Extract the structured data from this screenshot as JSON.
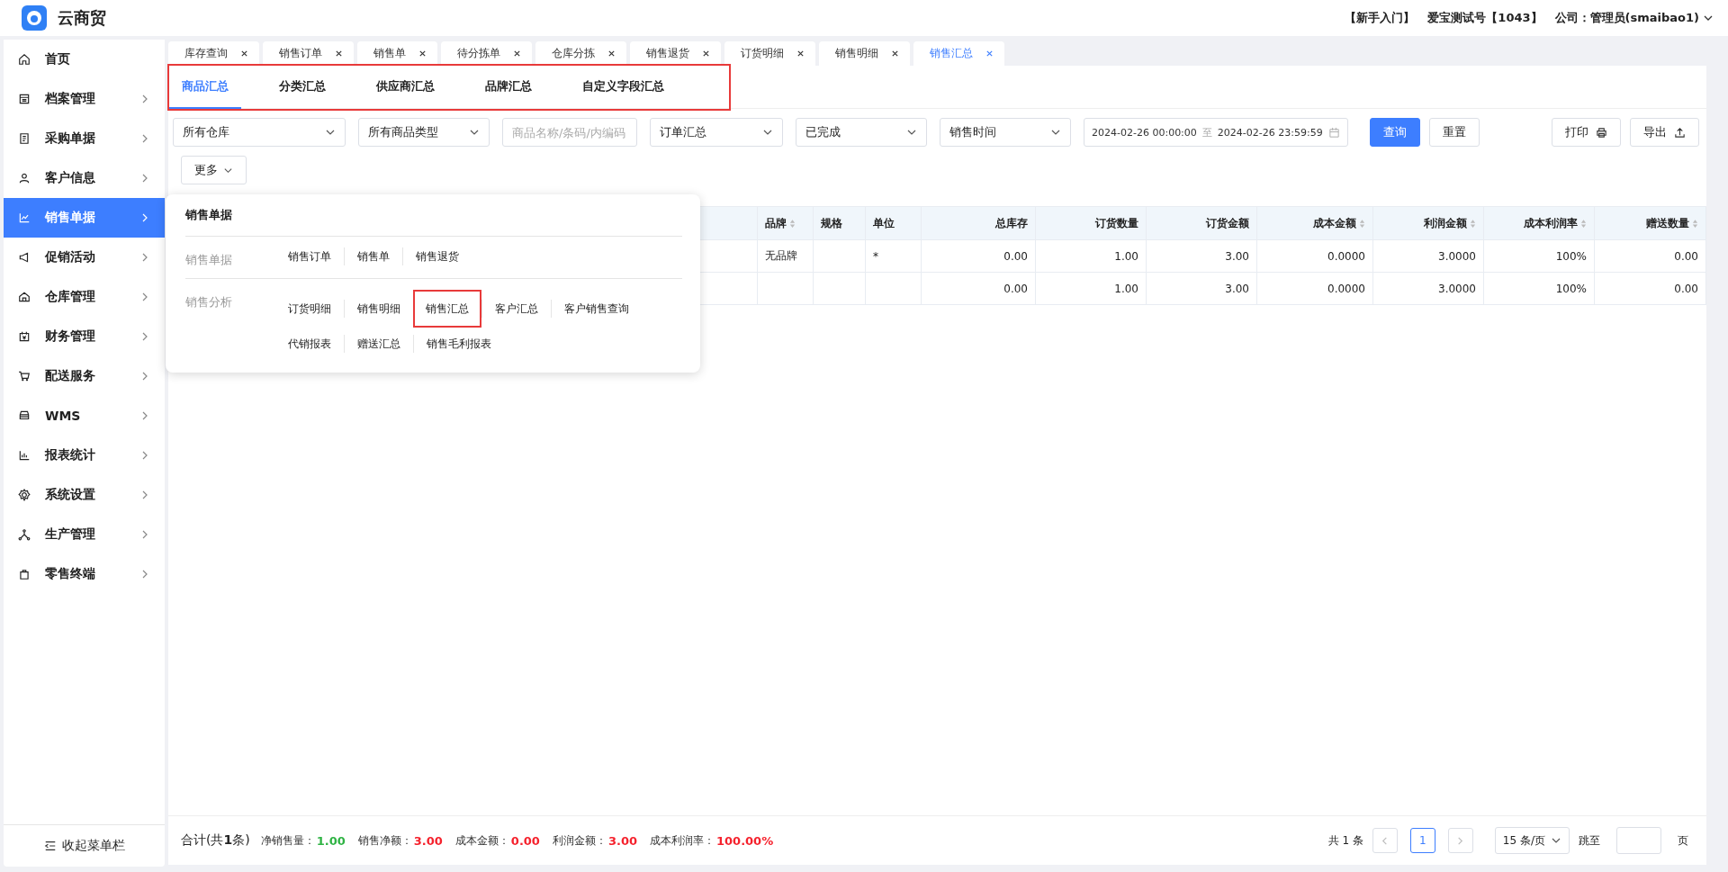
{
  "app": {
    "name": "云商贸"
  },
  "header": {
    "links": [
      "【新手入门】",
      "爱宝测试号【1043】",
      "公司：管理员(smaibao1)"
    ]
  },
  "sidebar": {
    "items": [
      {
        "label": "首页",
        "selected": false,
        "has_arrow": false
      },
      {
        "label": "档案管理",
        "selected": false,
        "has_arrow": true
      },
      {
        "label": "采购单据",
        "selected": false,
        "has_arrow": true
      },
      {
        "label": "客户信息",
        "selected": false,
        "has_arrow": true
      },
      {
        "label": "销售单据",
        "selected": true,
        "has_arrow": true
      },
      {
        "label": "促销活动",
        "selected": false,
        "has_arrow": true
      },
      {
        "label": "仓库管理",
        "selected": false,
        "has_arrow": true
      },
      {
        "label": "财务管理",
        "selected": false,
        "has_arrow": true
      },
      {
        "label": "配送服务",
        "selected": false,
        "has_arrow": true
      },
      {
        "label": "WMS",
        "selected": false,
        "has_arrow": true
      },
      {
        "label": "报表统计",
        "selected": false,
        "has_arrow": true
      },
      {
        "label": "系统设置",
        "selected": false,
        "has_arrow": true
      },
      {
        "label": "生产管理",
        "selected": false,
        "has_arrow": true
      },
      {
        "label": "零售终端",
        "selected": false,
        "has_arrow": true
      }
    ],
    "collapse_label": "收起菜单栏"
  },
  "tabs": [
    {
      "label": "库存查询",
      "selected": false
    },
    {
      "label": "销售订单",
      "selected": false
    },
    {
      "label": "销售单",
      "selected": false
    },
    {
      "label": "待分拣单",
      "selected": false
    },
    {
      "label": "仓库分拣",
      "selected": false
    },
    {
      "label": "销售退货",
      "selected": false
    },
    {
      "label": "订货明细",
      "selected": false
    },
    {
      "label": "销售明细",
      "selected": false
    },
    {
      "label": "销售汇总",
      "selected": true
    }
  ],
  "subtabs": {
    "highlighted": true,
    "items": [
      {
        "label": "商品汇总",
        "selected": true
      },
      {
        "label": "分类汇总",
        "selected": false
      },
      {
        "label": "供应商汇总",
        "selected": false
      },
      {
        "label": "品牌汇总",
        "selected": false
      },
      {
        "label": "自定义字段汇总",
        "selected": false
      }
    ]
  },
  "filters": [
    {
      "kind": "select",
      "value": "所有仓库"
    },
    {
      "kind": "select",
      "value": "所有商品类型"
    },
    {
      "kind": "input",
      "placeholder": "商品名称/条码/内编码"
    },
    {
      "kind": "select",
      "value": "订单汇总"
    },
    {
      "kind": "select",
      "value": "已完成"
    },
    {
      "kind": "select",
      "value": "销售时间"
    },
    {
      "kind": "daterange",
      "start": "2024-02-26 00:00:00",
      "separator": "至",
      "end": "2024-02-26 23:59:59"
    }
  ],
  "buttons": [
    {
      "label": "查询",
      "kind": "primary"
    },
    {
      "label": "重置",
      "kind": "default"
    }
  ],
  "tools": [
    {
      "label": "打印",
      "kind": "print"
    },
    {
      "label": "导出",
      "kind": "export"
    }
  ],
  "more_button": "更多",
  "table": {
    "columns": [
      {
        "label": "品牌",
        "sortable": true
      },
      {
        "label": "规格",
        "sortable": false
      },
      {
        "label": "单位",
        "sortable": false
      },
      {
        "label": "总库存",
        "sortable": false
      },
      {
        "label": "订货数量",
        "sortable": false
      },
      {
        "label": "订货金额",
        "sortable": false
      },
      {
        "label": "成本金额",
        "sortable": true
      },
      {
        "label": "利润金额",
        "sortable": true
      },
      {
        "label": "成本利润率",
        "sortable": true
      },
      {
        "label": "赠送数量",
        "sortable": true
      }
    ],
    "rows": [
      [
        "无品牌",
        "",
        "*",
        "0.00",
        "1.00",
        "3.00",
        "0.0000",
        "3.0000",
        "100%",
        "0.00"
      ],
      [
        "",
        "",
        "",
        "0.00",
        "1.00",
        "3.00",
        "0.0000",
        "3.0000",
        "100%",
        "0.00"
      ]
    ]
  },
  "popup": {
    "title": "销售单据",
    "groups": [
      {
        "label": "销售单据",
        "rows": [
          [
            {
              "label": "销售订单",
              "highlighted": false
            },
            {
              "label": "销售单",
              "highlighted": false
            },
            {
              "label": "销售退货",
              "highlighted": false
            }
          ]
        ]
      },
      {
        "label": "销售分析",
        "rows": [
          [
            {
              "label": "订货明细",
              "highlighted": false
            },
            {
              "label": "销售明细",
              "highlighted": false
            },
            {
              "label": "销售汇总",
              "highlighted": true
            },
            {
              "label": "客户汇总",
              "highlighted": false
            },
            {
              "label": "客户销售查询",
              "highlighted": false
            }
          ],
          [
            {
              "label": "代销报表",
              "highlighted": false
            },
            {
              "label": "赠送汇总",
              "highlighted": false
            },
            {
              "label": "销售毛利报表",
              "highlighted": false
            }
          ]
        ]
      }
    ]
  },
  "footer": {
    "total": "合计(共**1**条)",
    "stats": [
      {
        "label": "净销售量：",
        "value": "1.00",
        "color": "#2fb344"
      },
      {
        "label": "销售净额：",
        "value": "3.00",
        "color": "#f5222d"
      },
      {
        "label": "成本金额：",
        "value": "0.00",
        "color": "#f5222d"
      },
      {
        "label": "利润金额：",
        "value": "3.00",
        "color": "#f5222d"
      },
      {
        "label": "成本利润率：",
        "value": "100.00%",
        "color": "#f5222d"
      }
    ],
    "count": "共 1 条",
    "pages": [
      {
        "label": "1",
        "selected": true
      }
    ],
    "page_size": "15 条/页",
    "jump_label": "跳至",
    "page_unit": "页"
  }
}
